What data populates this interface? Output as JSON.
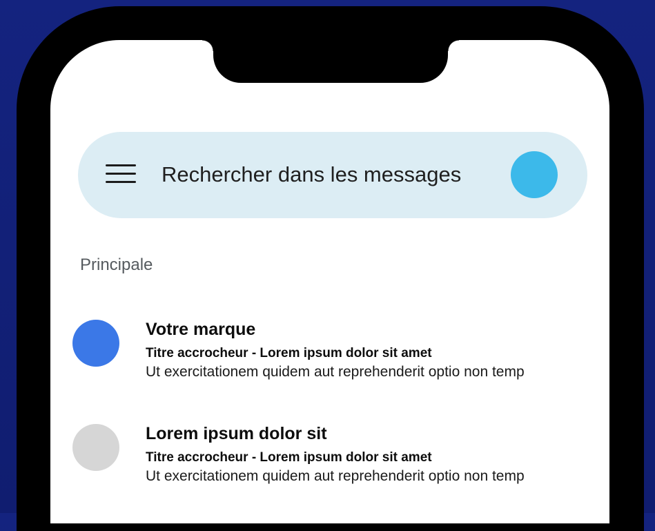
{
  "search": {
    "placeholder": "Rechercher dans les messages"
  },
  "section": {
    "label": "Principale"
  },
  "colors": {
    "background": "#13217a",
    "search_bar": "#dcedf4",
    "avatar_account": "#3cb9ea"
  },
  "icons": {
    "menu": "hamburger-menu-icon"
  },
  "messages": [
    {
      "sender": "Votre marque",
      "subject": "Titre accrocheur - Lorem ipsum dolor sit amet",
      "snippet": "Ut exercitationem quidem aut reprehenderit optio non temp",
      "avatar_color": "#3b78e7"
    },
    {
      "sender": "Lorem ipsum dolor sit",
      "subject": "Titre accrocheur - Lorem ipsum dolor sit amet",
      "snippet": "Ut exercitationem quidem aut reprehenderit optio non temp",
      "avatar_color": "#d6d6d6"
    }
  ]
}
